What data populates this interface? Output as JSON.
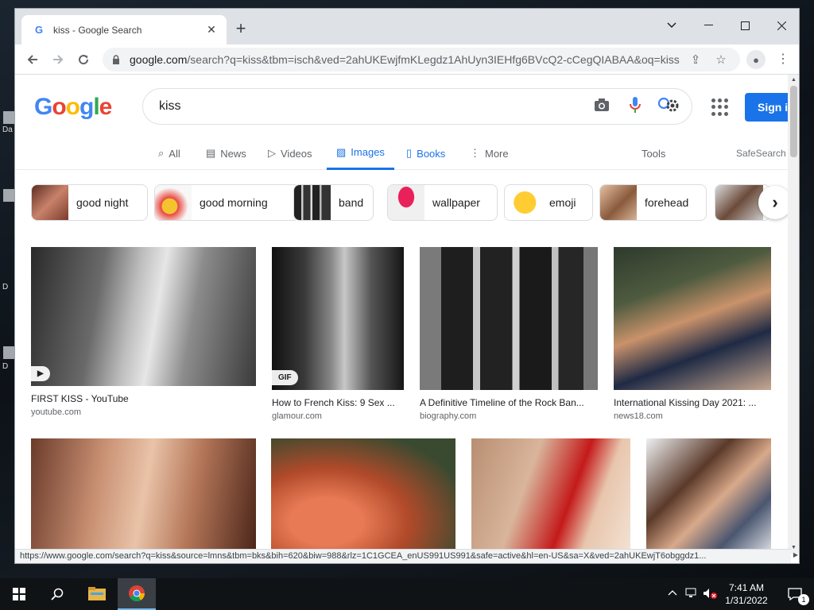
{
  "browser": {
    "tab_title": "kiss - Google Search",
    "tab_close": "✕",
    "new_tab": "+",
    "url_host": "google.com",
    "url_path": "/search?q=kiss&tbm=isch&ved=2ahUKEwjfmKLegdz1AhUyn3IEHfg6BVcQ2-cCegQIABAA&oq=kiss...",
    "status_url": "https://www.google.com/search?q=kiss&source=lmns&tbm=bks&bih=620&biw=988&rlz=1C1GCEA_enUS991US991&safe=active&hl=en-US&sa=X&ved=2ahUKEwjT6obggdz1..."
  },
  "google": {
    "logo": [
      "G",
      "o",
      "o",
      "g",
      "l",
      "e"
    ],
    "logo_colors": [
      "#4285f4",
      "#ea4335",
      "#fbbc05",
      "#4285f4",
      "#34a853",
      "#ea4335"
    ],
    "query": "kiss",
    "sign_in": "Sign i",
    "tabs": [
      {
        "label": "All",
        "icon": "⌕"
      },
      {
        "label": "News",
        "icon": "▤"
      },
      {
        "label": "Videos",
        "icon": "▷"
      },
      {
        "label": "Images",
        "icon": "▨"
      },
      {
        "label": "Books",
        "icon": "▯"
      },
      {
        "label": "More",
        "icon": "⋮"
      }
    ],
    "tools": "Tools",
    "safesearch": "SafeSearch",
    "chips": [
      "good night",
      "good morning",
      "band",
      "wallpaper",
      "emoji",
      "forehead"
    ],
    "results_row1": [
      {
        "title": "FIRST KISS - YouTube",
        "source": "youtube.com",
        "badge": "▶"
      },
      {
        "title": "How to French Kiss: 9 Sex ...",
        "source": "glamour.com",
        "badge": "GIF"
      },
      {
        "title": "A Definitive Timeline of the Rock Ban...",
        "source": "biography.com",
        "badge": ""
      },
      {
        "title": "International Kissing Day 2021: ...",
        "source": "news18.com",
        "badge": ""
      }
    ]
  },
  "taskbar": {
    "time": "7:41 AM",
    "date": "1/31/2022",
    "notif_count": "1"
  },
  "desktop": {
    "labels": [
      "Da",
      "D",
      "D"
    ]
  }
}
